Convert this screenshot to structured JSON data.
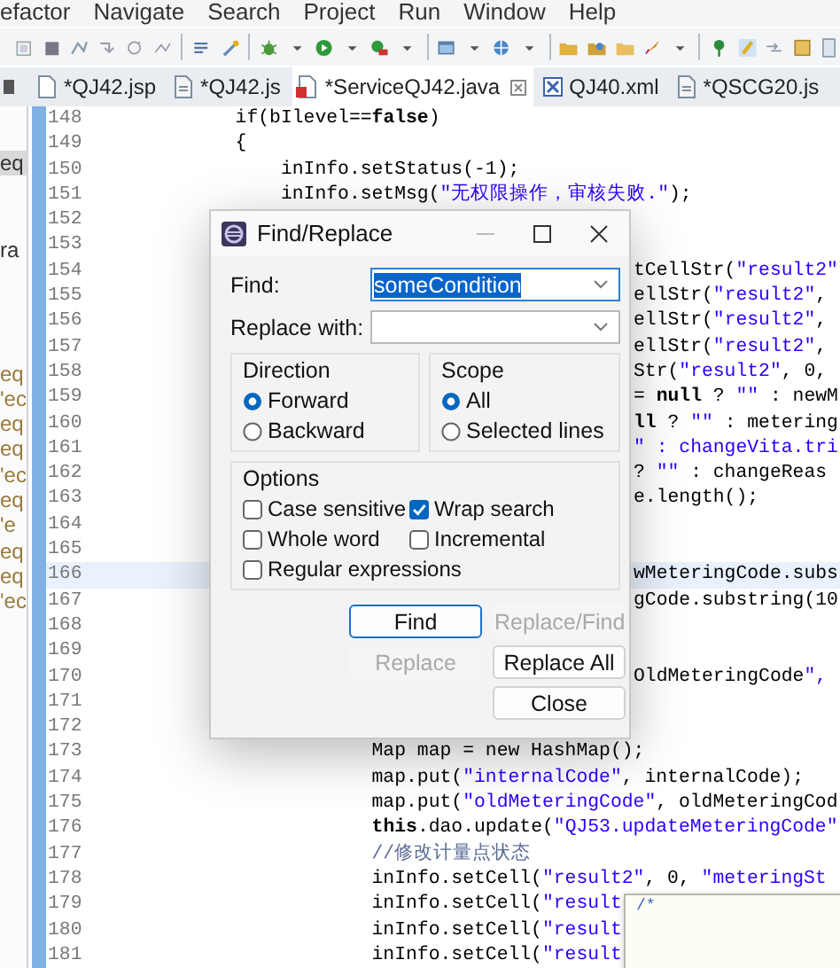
{
  "menu_bar": [
    {
      "label": "efactor"
    },
    {
      "label": "Navigate"
    },
    {
      "label": "Search"
    },
    {
      "label": "Project"
    },
    {
      "label": "Run"
    },
    {
      "label": "Window"
    },
    {
      "label": "Help"
    }
  ],
  "tabs": [
    {
      "label": "*QJ42.jsp",
      "kind": "jsp",
      "selected": false
    },
    {
      "label": "*QJ42.js",
      "kind": "js",
      "selected": false
    },
    {
      "label": "*ServiceQJ42.java",
      "kind": "java",
      "selected": true
    },
    {
      "label": "QJ40.xml",
      "kind": "xml",
      "selected": false
    },
    {
      "label": "*QSCG20.js",
      "kind": "js",
      "selected": false
    }
  ],
  "package_explorer": {
    "items": [
      {
        "label": "eq",
        "selected": true,
        "color": "#333333"
      },
      {
        "label": "ra",
        "selected": false,
        "color": "#333333"
      },
      {
        "label": "eq",
        "selected": false,
        "color": "#9a7b3c"
      },
      {
        "label": "'ec",
        "selected": false,
        "color": "#9a7b3c"
      },
      {
        "label": "eq",
        "selected": false,
        "color": "#9a7b3c"
      },
      {
        "label": "eq",
        "selected": false,
        "color": "#9a7b3c"
      },
      {
        "label": "'ec",
        "selected": false,
        "color": "#9a7b3c"
      },
      {
        "label": "eq",
        "selected": false,
        "color": "#9a7b3c"
      },
      {
        "label": "'e",
        "selected": false,
        "color": "#9a7b3c"
      },
      {
        "label": "eq",
        "selected": false,
        "color": "#9a7b3c"
      },
      {
        "label": "eq",
        "selected": false,
        "color": "#9a7b3c"
      },
      {
        "label": "'ec",
        "selected": false,
        "color": "#9a7b3c"
      }
    ]
  },
  "editor": {
    "lines": [
      {
        "number": "148",
        "text": "        if(bIlevel==**false**)",
        "current": false
      },
      {
        "number": "149",
        "text": "        {",
        "current": false
      },
      {
        "number": "150",
        "text": "            inInfo.setStatus(-1);",
        "current": false
      },
      {
        "number": "151",
        "text": "            inInfo.setMsg(\"无权限操作，审核失败.\");",
        "current": false
      },
      {
        "number": "152",
        "current": false
      },
      {
        "number": "153",
        "current": false
      },
      {
        "number": "154",
        "right_text": "tCellStr(\"result2\"",
        "current": false
      },
      {
        "number": "155",
        "right_text": "ellStr(\"result2\",",
        "current": false
      },
      {
        "number": "156",
        "right_text": "ellStr(\"result2\",",
        "current": false
      },
      {
        "number": "157",
        "right_text": "ellStr(\"result2\",",
        "current": false
      },
      {
        "number": "158",
        "right_text": "Str(\"result2\", 0,",
        "current": false
      },
      {
        "number": "159",
        "right_text": "= **null** ? \"\" : newM",
        "current": false
      },
      {
        "number": "160",
        "right_text": "**ll** ? \"\" : metering",
        "current": false
      },
      {
        "number": "161",
        "right_text": "\" : changeVita.tri",
        "current": false
      },
      {
        "number": "162",
        "right_text": "? \"\" : changeReas",
        "current": false
      },
      {
        "number": "163",
        "right_text": "e.length();",
        "current": false
      },
      {
        "number": "164",
        "current": false
      },
      {
        "number": "165",
        "current": false
      },
      {
        "number": "166",
        "right_text": "wMeteringCode.subs",
        "current": true
      },
      {
        "number": "167",
        "right_text": "gCode.substring(10",
        "current": false
      },
      {
        "number": "168",
        "current": false
      },
      {
        "number": "169",
        "current": false
      },
      {
        "number": "170",
        "right_text": "OldMeteringCode\",",
        "current": false
      },
      {
        "number": "171",
        "current": false
      },
      {
        "number": "172",
        "current": false
      },
      {
        "number": "173",
        "text": "                    Map map = new HashMap();",
        "current": false
      },
      {
        "number": "174",
        "text": "                    map.put(\"internalCode\", internalCode);",
        "current": false
      },
      {
        "number": "175",
        "text": "                    map.put(\"oldMeteringCode\", oldMeteringCod",
        "current": false
      },
      {
        "number": "176",
        "text": "                    **this**.dao.update(\"QJ53.updateMeteringCode\"",
        "current": false
      },
      {
        "number": "177",
        "text": "                    //修改计量点状态",
        "kind": "comment",
        "current": false
      },
      {
        "number": "178",
        "text": "                    inInfo.setCell(\"result2\", 0, \"meteringSt",
        "current": false
      },
      {
        "number": "179",
        "text": "                    inInfo.setCell(\"result",
        "current": false
      },
      {
        "number": "180",
        "text": "                    inInfo.setCell(\"result",
        "current": false
      },
      {
        "number": "181",
        "text": "                    inInfo.setCell(\"result",
        "current": false
      }
    ]
  },
  "hover_popup": {
    "lines": [
      "/*"
    ]
  },
  "dialog": {
    "title": "Find/Replace",
    "find": {
      "label": "Find:",
      "value": "someCondition",
      "value_selected": true
    },
    "replace": {
      "label": "Replace with:"
    },
    "direction": {
      "title": "Direction",
      "options": [
        {
          "label": "Forward",
          "selected": true
        },
        {
          "label": "Backward",
          "selected": false
        }
      ]
    },
    "scope": {
      "title": "Scope",
      "options": [
        {
          "label": "All",
          "selected": true
        },
        {
          "label": "Selected lines",
          "selected": false
        }
      ]
    },
    "options": {
      "title": "Options",
      "items": [
        {
          "label": "Case sensitive",
          "checked": false
        },
        {
          "label": "Wrap search",
          "checked": true
        },
        {
          "label": "Whole word",
          "checked": false
        },
        {
          "label": "Incremental",
          "checked": false
        },
        {
          "label": "Regular expressions",
          "checked": false
        }
      ]
    },
    "buttons": [
      {
        "label": "Find",
        "disabled": false,
        "default": true
      },
      {
        "label": "Replace/Find",
        "disabled": true,
        "default": false
      },
      {
        "label": "Replace",
        "disabled": true,
        "default": false
      },
      {
        "label": "Replace All",
        "disabled": false,
        "default": false
      },
      {
        "label": "Close",
        "disabled": false,
        "default": false
      }
    ]
  }
}
